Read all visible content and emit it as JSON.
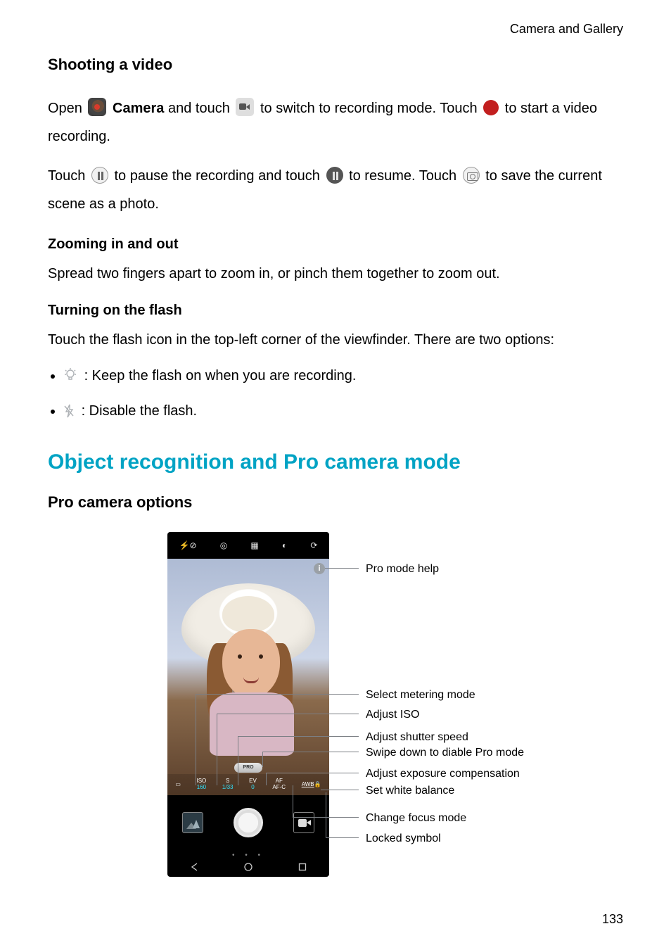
{
  "breadcrumb": "Camera and Gallery",
  "headings": {
    "shooting": "Shooting a video",
    "zoom": "Zooming in and out",
    "flash": "Turning on the flash",
    "major": "Object recognition and Pro camera mode",
    "pro_opts": "Pro camera options"
  },
  "p_open_1": "Open ",
  "p_open_camera": "Camera",
  "p_open_2": " and touch ",
  "p_open_3": " to switch to recording mode. Touch ",
  "p_open_4": " to start a video recording.",
  "p_pause_1": "Touch ",
  "p_pause_2": " to pause the recording and touch ",
  "p_pause_3": " to resume. Touch ",
  "p_pause_4": " to save the current scene as a photo.",
  "p_zoom": "Spread two fingers apart to zoom in, or pinch them together to zoom out.",
  "p_flash_intro": "Touch the flash icon in the top-left corner of the viewfinder. There are two options:",
  "flash_on": " : Keep the flash on when you are recording.",
  "flash_off": " : Disable the flash.",
  "diagram": {
    "pro_help": "Pro mode help",
    "metering": "Select metering mode",
    "iso": "Adjust ISO",
    "shutter": "Adjust shutter speed",
    "swipe": "Swipe down to diable Pro mode",
    "ev": "Adjust exposure compensation",
    "wb": "Set white balance",
    "focus": "Change focus mode",
    "lock": "Locked symbol",
    "phone_top": {
      "flash": "⚡⊘",
      "aperture": "◎",
      "filter": "▦",
      "hdr": "◐",
      "switch": "⟳"
    },
    "pro_row": {
      "meter": "▭",
      "iso_t": "ISO",
      "iso_v": "160",
      "s_t": "S",
      "s_v": "1/33",
      "ev_t": "EV",
      "ev_v": "0",
      "af_t": "AF",
      "af_v": "AF-C",
      "awb_t": "AWB",
      "awb_lock": "🔒"
    },
    "pro_pill": "PRO",
    "info": "i"
  },
  "page_number": "133"
}
